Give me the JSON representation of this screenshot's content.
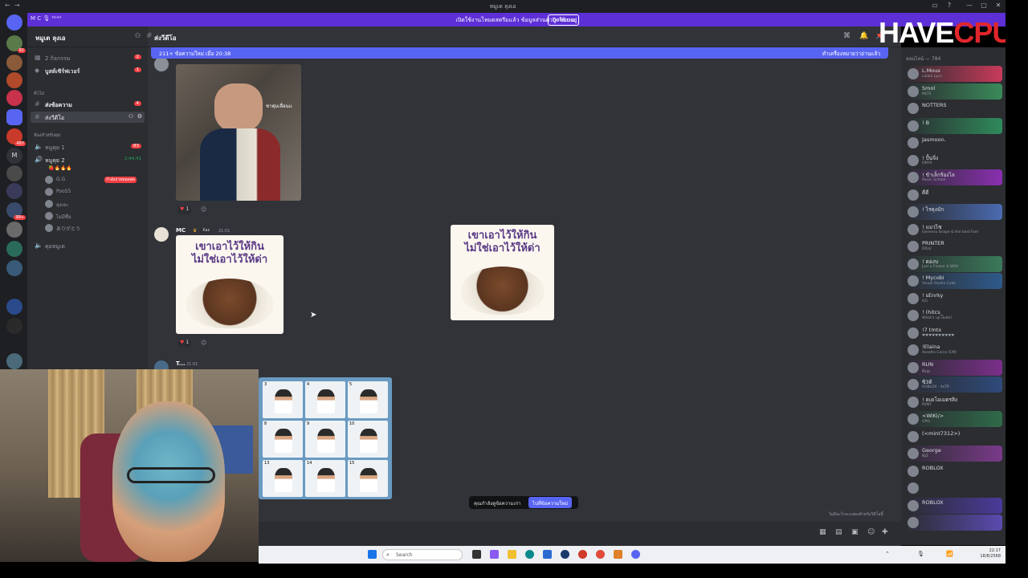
{
  "window": {
    "title": "หมูเด ลุงเอ",
    "controls": [
      "▭",
      "?",
      "—",
      "▢",
      "✕"
    ]
  },
  "notice": {
    "left_label": "M C 🎙 ᴰᵉᵃᵈ",
    "message": "เปิดใช้งานโหมดสตรีมแล้ว ข้อมูลส่วนตัวถูกซ่อนอยู่",
    "button": "ปิดใช้งาน"
  },
  "server": {
    "name": "หมูเด ลุงเอ",
    "rail_badges": [
      "91",
      "487",
      "99+"
    ]
  },
  "sidebar": {
    "top_items": [
      {
        "label": "2 กิจกรรม",
        "badge": "2"
      },
      {
        "label": "บูสต์เซิร์ฟเวอร์",
        "badge": "1"
      }
    ],
    "category_text": "ทั่วไป",
    "text_channels": [
      {
        "label": "ส่งข้อความ",
        "badge": "4"
      },
      {
        "label": "ส่งวีดีโอ",
        "badge": ""
      }
    ],
    "voice_category": "ห้องสำหรับคุย",
    "voice_channels": [
      {
        "label": "หมูคุย 1",
        "badge": "83"
      },
      {
        "label": "หมูคุย 2",
        "badge": "2:44:41"
      }
    ],
    "voice_status": "🍓🔥🔥🔥",
    "voice_users": [
      "G.G",
      "Poo55",
      "ลุงเอะ",
      "ไม่มีชื่อ",
      "ありがとう"
    ],
    "live_badge": "กำลังถ่ายทอดสด",
    "last_channel": "คุยหมูเด"
  },
  "chat": {
    "channel": "ส่งวีดีโอ",
    "new_messages": "211+ ข้อความใหม่ เมื่อ 20:38",
    "mark_read": "ทำเครื่องหมายว่าอ่านแล้ว",
    "photo_watermark": "ชาตุ่มเลื่อนแ",
    "messages": [
      {
        "author": "MC",
        "tag": "Xaz",
        "time": "21:01",
        "reaction_count": "1"
      },
      {
        "author": "T...",
        "time": "21:01"
      }
    ],
    "sticker_text_line1": "เขาเอาไว้ให้กิน",
    "sticker_text_line2": "ไม่ใช่เอาไว้ให้ด่า",
    "reaction_top_count": "1",
    "jump_prompt": "คุณกำลังดูข้อความเก่า",
    "jump_button": "ไปที่ข้อความใหม่",
    "typing_hint": "ไม่มีอะไรจะแสดงสำหรับวิดีโอนี้"
  },
  "collage_numbers": [
    "3",
    "4",
    "5",
    "8",
    "9",
    "10",
    "13",
    "14",
    "15"
  ],
  "members": {
    "header": "ออนไลน์ — 784",
    "list": [
      {
        "name": "L.Mous",
        "sub": "Lalalá Lpro",
        "color": "#c93a5a"
      },
      {
        "name": "Smol",
        "sub": "MLTS",
        "color": "#3a8a5a"
      },
      {
        "name": "NOTTERS",
        "sub": "",
        "color": ""
      },
      {
        "name": "! B",
        "sub": "",
        "color": "#2f8a5a"
      },
      {
        "name": "Jasmoon.",
        "sub": "",
        "color": ""
      },
      {
        "name": "! ปั้นจิ่ง",
        "sub": "ONYX",
        "color": ""
      },
      {
        "name": "! ข้าเล็กร้องไล",
        "sub": "Music School",
        "color": "#8a2fb0"
      },
      {
        "name": "ดีดี",
        "sub": "",
        "color": ""
      },
      {
        "name": "! ไรคุงมัก",
        "sub": "",
        "color": "#4a6ab0"
      },
      {
        "name": "! แมวไซ",
        "sub": "Genevra Snape & the best Fam",
        "color": ""
      },
      {
        "name": "PRINTER",
        "sub": "DRLV",
        "color": ""
      },
      {
        "name": "! ตองบ",
        "sub": "Just a Flower & WAV",
        "color": "#3a7a5a"
      },
      {
        "name": "! Mycobi",
        "sub": "Visual Studio Code",
        "color": "#2f5a8a"
      },
      {
        "name": "! sEnrky",
        "sub": "GG",
        "color": ""
      },
      {
        "name": "! (hitcs_",
        "sub": "What's up dude?",
        "color": ""
      },
      {
        "name": "!7 tmtx",
        "sub": "♥♥♥♥♥♥♥♥♥♥",
        "color": ""
      },
      {
        "name": "!Elaina",
        "sub": "Assetto Corsa (CM)",
        "color": ""
      },
      {
        "name": "RUN",
        "sub": "ดิ้งปุ่ง",
        "color": "#7a2f8a"
      },
      {
        "name": "ซิ3ดิ",
        "sub": "ROBLOX · AsTR",
        "color": "#2f4a7a"
      },
      {
        "name": "! ดเดโอเมตรสิง",
        "sub": "RVNT",
        "color": ""
      },
      {
        "name": "<WiKi/>",
        "sub": "GPO",
        "color": "#2f6a4a"
      },
      {
        "name": "(<mint7312>)",
        "sub": "",
        "color": ""
      },
      {
        "name": "George",
        "sub": "NJZ",
        "color": "#7a3a8a"
      },
      {
        "name": "ROBLOX",
        "sub": "",
        "color": ""
      },
      {
        "name": "",
        "sub": "",
        "color": ""
      },
      {
        "name": "ROBLOX",
        "sub": "",
        "color": "#4a3a9a"
      },
      {
        "name": "",
        "sub": "",
        "color": "#5a4ab0"
      }
    ]
  },
  "watermark": {
    "a": "HAVE",
    "b": "CPU"
  },
  "taskbar": {
    "search": "Search",
    "time": "22:17",
    "date": "18/8/2568"
  },
  "accent": "#5865f2"
}
